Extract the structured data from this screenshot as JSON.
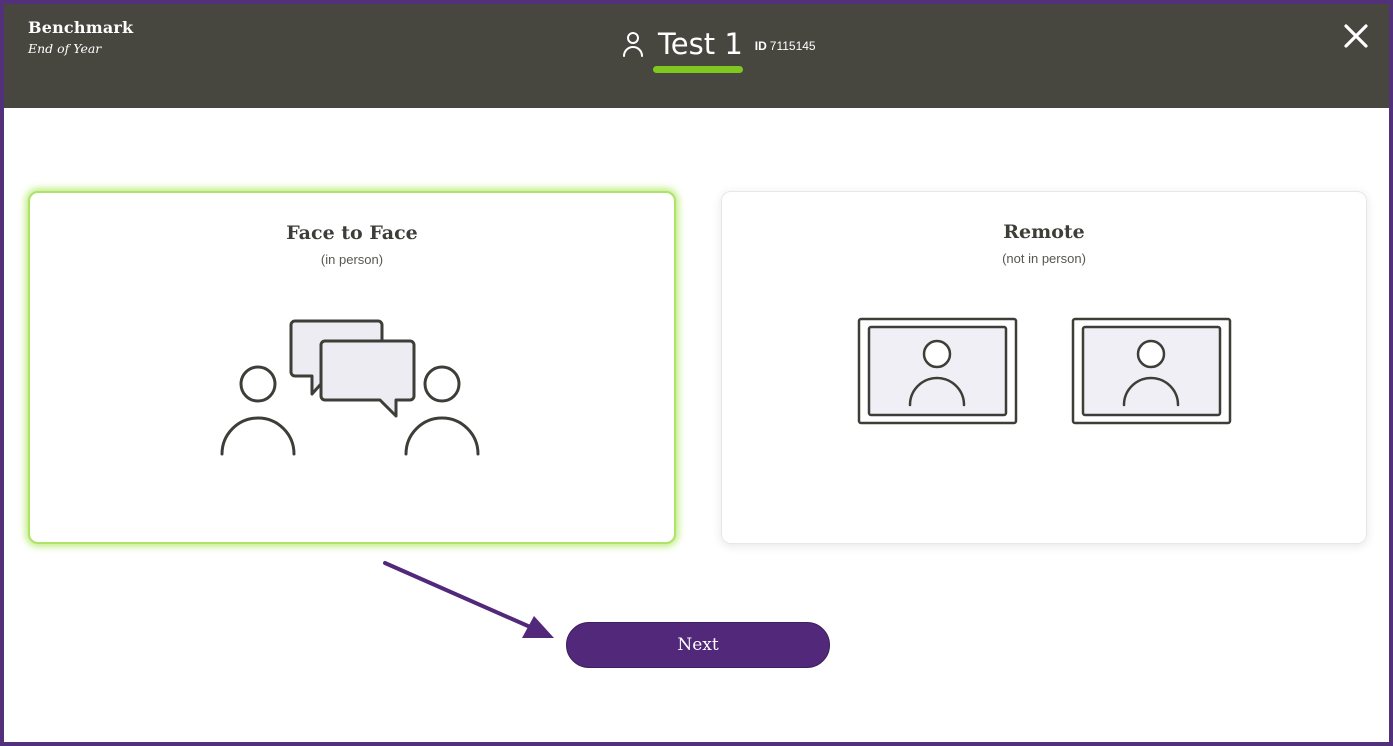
{
  "header": {
    "title": "Benchmark",
    "subtitle": "End of Year",
    "student_name": "Test 1",
    "id_label": "ID",
    "id_value": "7115145"
  },
  "options": [
    {
      "title": "Face to Face",
      "subtitle": "(in person)",
      "icon": "people-conversation-icon",
      "selected": true
    },
    {
      "title": "Remote",
      "subtitle": "(not in person)",
      "icon": "video-screens-icon",
      "selected": false
    }
  ],
  "next_label": "Next",
  "colors": {
    "header_bg": "#474740",
    "accent_green": "#7ec81f",
    "selected_border": "#aee36a",
    "primary_purple": "#52287a",
    "screen_fill": "#f1eff6",
    "icon_stroke": "#3e3e38"
  }
}
